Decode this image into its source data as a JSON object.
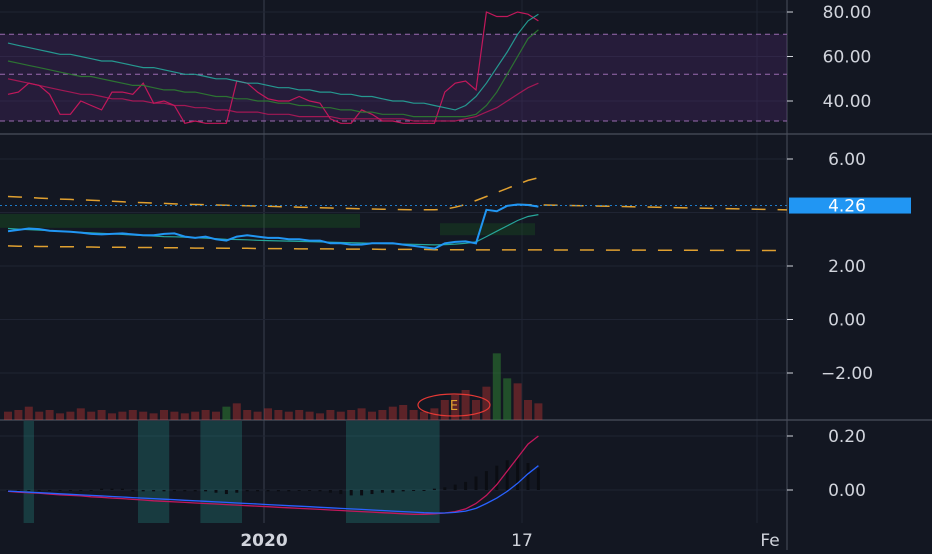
{
  "colors": {
    "background": "#131722",
    "grid": "#1f2433",
    "separator": "#4a4f5c",
    "axis_text": "#d1d4dc",
    "price_line": "#2196f3",
    "price_label_bg": "#2196f3",
    "envelope": "#e0a030",
    "rsi_line": "#c2185b",
    "rsi_band": "#5a2a7a",
    "avg_line": "#26a69a",
    "volume": "#e53935",
    "volume_up": "#2e7d32",
    "osc_zone": "#26a69a",
    "earnings": "#e53935"
  },
  "price_label": "4.26",
  "earnings_marker": "E",
  "chart_data": [
    {
      "type": "line",
      "pane": "rsi",
      "y_ticks": [
        40,
        60,
        80
      ],
      "y_tick_labels": [
        "40.00",
        "60.00",
        "80.00"
      ],
      "ylim": [
        31,
        82
      ],
      "bands": [
        70,
        52,
        31
      ],
      "series": [
        {
          "values": [
            43,
            44,
            48,
            47,
            43,
            34,
            34,
            40,
            38,
            36,
            44,
            44,
            43,
            48,
            39,
            40,
            38,
            30,
            31,
            30,
            30,
            30,
            49,
            48,
            44,
            41,
            40,
            40,
            42,
            40,
            39,
            32,
            30,
            30,
            36,
            34,
            31,
            31,
            30,
            30,
            30,
            30,
            44,
            48,
            49,
            45,
            80,
            78,
            78,
            80,
            79,
            76
          ]
        },
        {
          "values": [
            66,
            65,
            64,
            63,
            62,
            61,
            61,
            60,
            59,
            58,
            58,
            57,
            56,
            55,
            55,
            54,
            53,
            52,
            52,
            51,
            50,
            50,
            49,
            48,
            48,
            47,
            46,
            46,
            45,
            45,
            44,
            44,
            43,
            43,
            42,
            42,
            41,
            40,
            40,
            39,
            39,
            38,
            37,
            36,
            38,
            42,
            48,
            55,
            62,
            70,
            76,
            79
          ]
        },
        {
          "values": [
            58,
            57,
            56,
            55,
            54,
            53,
            52,
            51,
            51,
            50,
            49,
            48,
            47,
            47,
            46,
            45,
            45,
            44,
            44,
            43,
            42,
            42,
            41,
            41,
            40,
            40,
            39,
            39,
            38,
            38,
            37,
            37,
            36,
            36,
            35,
            35,
            34,
            34,
            34,
            33,
            33,
            33,
            33,
            33,
            33,
            34,
            38,
            44,
            52,
            60,
            68,
            72
          ]
        },
        {
          "values": [
            50,
            49,
            48,
            47,
            46,
            45,
            44,
            43,
            43,
            42,
            41,
            41,
            40,
            40,
            39,
            39,
            38,
            38,
            37,
            37,
            36,
            36,
            35,
            35,
            35,
            34,
            34,
            34,
            33,
            33,
            33,
            33,
            32,
            32,
            32,
            32,
            32,
            32,
            32,
            31,
            31,
            31,
            31,
            31,
            32,
            33,
            35,
            37,
            40,
            43,
            46,
            48
          ]
        }
      ]
    },
    {
      "type": "line",
      "pane": "price",
      "y_ticks": [
        -2,
        0,
        2,
        6
      ],
      "y_tick_labels": [
        "−2.00",
        "0.00",
        "2.00",
        "6.00"
      ],
      "ylim": [
        -3.6,
        6.5
      ],
      "last_value": 4.26,
      "series": [
        {
          "values": [
            3.3,
            3.35,
            3.4,
            3.38,
            3.32,
            3.3,
            3.28,
            3.25,
            3.2,
            3.18,
            3.2,
            3.22,
            3.18,
            3.15,
            3.15,
            3.2,
            3.22,
            3.1,
            3.05,
            3.1,
            3.0,
            2.95,
            3.1,
            3.15,
            3.1,
            3.05,
            3.05,
            3.0,
            3.0,
            2.95,
            2.95,
            2.85,
            2.85,
            2.8,
            2.8,
            2.85,
            2.85,
            2.85,
            2.8,
            2.75,
            2.7,
            2.65,
            2.85,
            2.9,
            2.92,
            2.85,
            4.1,
            4.05,
            4.25,
            4.3,
            4.28,
            4.22
          ]
        },
        {
          "values": [
            3.4,
            3.38,
            3.36,
            3.34,
            3.32,
            3.3,
            3.28,
            3.26,
            3.24,
            3.22,
            3.2,
            3.18,
            3.16,
            3.14,
            3.12,
            3.1,
            3.09,
            3.08,
            3.06,
            3.04,
            3.02,
            3.0,
            2.99,
            2.98,
            2.96,
            2.95,
            2.94,
            2.93,
            2.92,
            2.91,
            2.9,
            2.89,
            2.88,
            2.87,
            2.86,
            2.85,
            2.84,
            2.83,
            2.82,
            2.81,
            2.8,
            2.79,
            2.8,
            2.82,
            2.85,
            2.9,
            3.1,
            3.3,
            3.5,
            3.7,
            3.85,
            3.92
          ]
        },
        {
          "values": [
            4.6,
            4.58,
            4.56,
            4.54,
            4.52,
            4.5,
            4.49,
            4.47,
            4.46,
            4.44,
            4.42,
            4.4,
            4.38,
            4.37,
            4.35,
            4.34,
            4.32,
            4.31,
            4.3,
            4.29,
            4.28,
            4.27,
            4.26,
            4.25,
            4.24,
            4.23,
            4.22,
            4.21,
            4.2,
            4.19,
            4.18,
            4.17,
            4.16,
            4.15,
            4.14,
            4.13,
            4.12,
            4.12,
            4.11,
            4.1,
            4.1,
            4.1,
            4.12,
            4.2,
            4.3,
            4.45,
            4.6,
            4.75,
            4.9,
            5.05,
            5.2,
            5.3
          ]
        },
        {
          "values": [
            2.75,
            2.74,
            2.74,
            2.73,
            2.73,
            2.72,
            2.72,
            2.71,
            2.71,
            2.7,
            2.7,
            2.7,
            2.69,
            2.69,
            2.69,
            2.68,
            2.68,
            2.68,
            2.67,
            2.67,
            2.67,
            2.66,
            2.66,
            2.66,
            2.65,
            2.65,
            2.65,
            2.65,
            2.64,
            2.64,
            2.64,
            2.64,
            2.63,
            2.63,
            2.63,
            2.63,
            2.62,
            2.62,
            2.62,
            2.62,
            2.62,
            2.61,
            2.61,
            2.61,
            2.61,
            2.6,
            2.6,
            2.6,
            2.6,
            2.6,
            2.6,
            2.6
          ]
        }
      ]
    },
    {
      "type": "bar",
      "pane": "volume",
      "values": [
        5,
        6,
        8,
        5,
        6,
        4,
        5,
        7,
        5,
        6,
        4,
        5,
        6,
        5,
        4,
        6,
        5,
        4,
        5,
        6,
        5,
        8,
        10,
        6,
        5,
        7,
        6,
        5,
        6,
        5,
        4,
        6,
        5,
        6,
        7,
        5,
        6,
        8,
        9,
        6,
        5,
        7,
        12,
        15,
        18,
        12,
        20,
        40,
        25,
        22,
        12,
        10
      ],
      "up_indices": [
        21,
        47,
        48
      ],
      "ylim": [
        0,
        45
      ]
    },
    {
      "type": "bar",
      "pane": "oscillator",
      "y_ticks": [
        0,
        0.2
      ],
      "y_tick_labels": [
        "0.00",
        "0.20"
      ],
      "ylim": [
        -0.12,
        0.25
      ],
      "values": [
        0,
        0,
        0,
        0,
        0,
        0,
        0,
        0,
        0,
        0.005,
        0.005,
        0.005,
        -0.005,
        -0.005,
        -0.005,
        -0.005,
        -0.005,
        -0.005,
        -0.005,
        -0.005,
        -0.01,
        -0.015,
        -0.01,
        -0.005,
        -0.005,
        -0.005,
        -0.005,
        -0.005,
        0,
        0,
        -0.005,
        -0.01,
        -0.015,
        -0.02,
        -0.02,
        -0.015,
        -0.01,
        -0.01,
        -0.005,
        0,
        0,
        0.005,
        0.01,
        0.02,
        0.03,
        0.05,
        0.07,
        0.09,
        0.11,
        0.12,
        0.1,
        0.08
      ],
      "series": [
        {
          "values": [
            -0.005,
            -0.008,
            -0.01,
            -0.012,
            -0.015,
            -0.018,
            -0.02,
            -0.022,
            -0.025,
            -0.027,
            -0.03,
            -0.032,
            -0.035,
            -0.037,
            -0.04,
            -0.042,
            -0.044,
            -0.046,
            -0.048,
            -0.05,
            -0.052,
            -0.054,
            -0.056,
            -0.058,
            -0.06,
            -0.062,
            -0.064,
            -0.066,
            -0.068,
            -0.07,
            -0.072,
            -0.074,
            -0.076,
            -0.078,
            -0.08,
            -0.082,
            -0.084,
            -0.086,
            -0.088,
            -0.09,
            -0.09,
            -0.088,
            -0.085,
            -0.08,
            -0.07,
            -0.05,
            -0.02,
            0.02,
            0.07,
            0.12,
            0.17,
            0.2
          ]
        },
        {
          "values": [
            -0.004,
            -0.006,
            -0.008,
            -0.01,
            -0.012,
            -0.014,
            -0.016,
            -0.018,
            -0.02,
            -0.022,
            -0.024,
            -0.026,
            -0.028,
            -0.03,
            -0.032,
            -0.034,
            -0.036,
            -0.038,
            -0.04,
            -0.042,
            -0.044,
            -0.046,
            -0.048,
            -0.05,
            -0.052,
            -0.054,
            -0.056,
            -0.058,
            -0.06,
            -0.062,
            -0.064,
            -0.066,
            -0.068,
            -0.07,
            -0.072,
            -0.074,
            -0.076,
            -0.078,
            -0.08,
            -0.082,
            -0.084,
            -0.085,
            -0.085,
            -0.083,
            -0.078,
            -0.068,
            -0.05,
            -0.03,
            -0.005,
            0.025,
            0.06,
            0.09
          ]
        }
      ],
      "zones": [
        [
          1.5,
          2.5
        ],
        [
          12.5,
          15.5
        ],
        [
          18.5,
          22.5
        ],
        [
          32.5,
          41.5
        ]
      ]
    }
  ],
  "x_axis": {
    "tick_labels": [
      "2020",
      "17",
      "Fe"
    ]
  }
}
